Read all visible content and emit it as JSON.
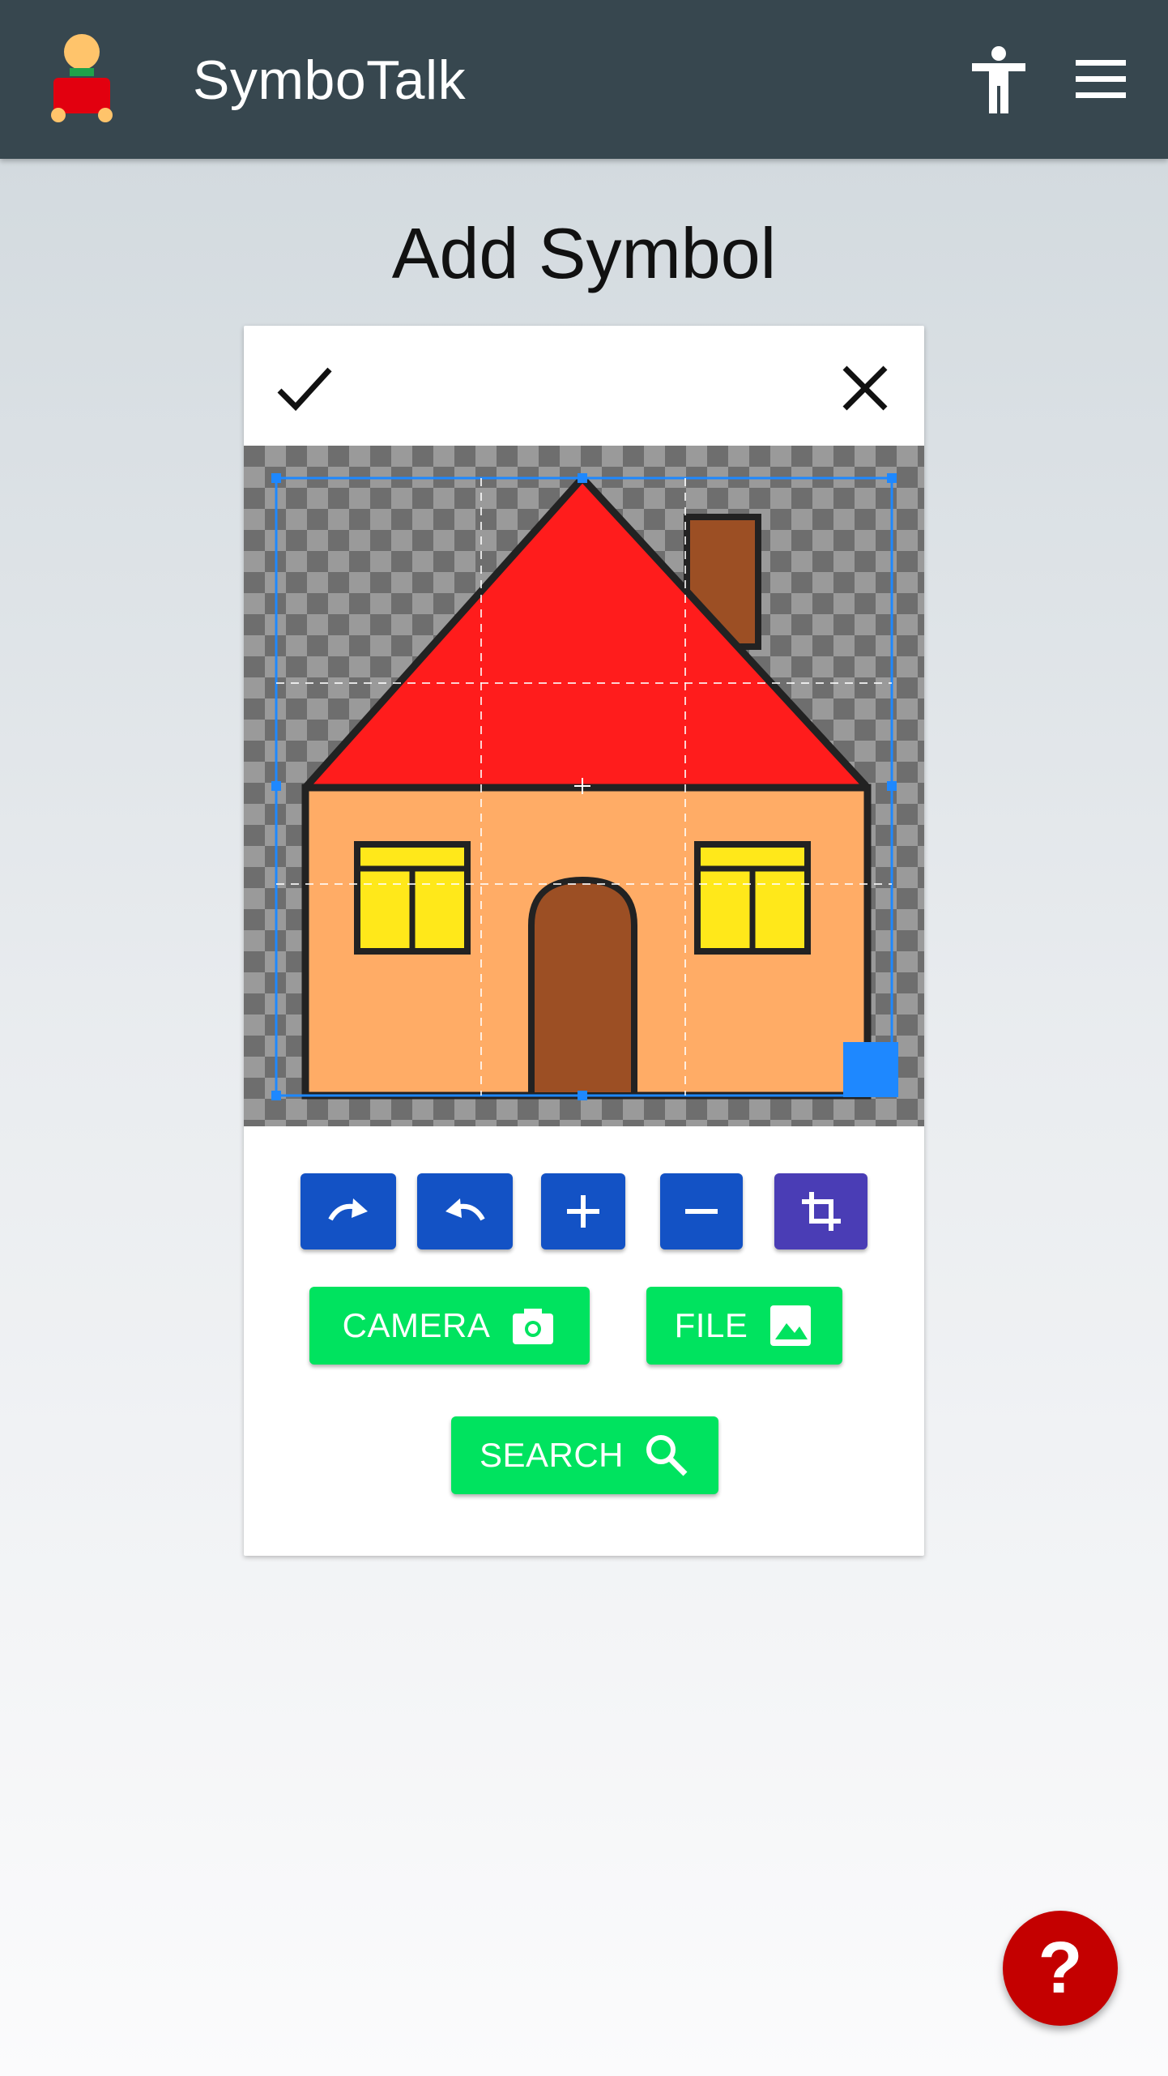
{
  "app": {
    "title": "SymboTalk"
  },
  "page": {
    "title": "Add Symbol"
  },
  "editor": {
    "image_subject": "house",
    "crop_handles": true
  },
  "tools": [
    {
      "name": "rotate-right",
      "icon": "redo-icon"
    },
    {
      "name": "rotate-left",
      "icon": "undo-icon"
    },
    {
      "name": "zoom-in",
      "icon": "plus-icon"
    },
    {
      "name": "zoom-out",
      "icon": "minus-icon"
    },
    {
      "name": "crop",
      "icon": "crop-icon"
    }
  ],
  "actions": {
    "camera_label": "CAMERA",
    "file_label": "FILE",
    "search_label": "SEARCH"
  },
  "help": {
    "label": "?"
  },
  "colors": {
    "appbar": "#37474f",
    "tool_blue": "#1352c5",
    "crop_purple": "#4a3db5",
    "action_green": "#00e35f",
    "help_red": "#c40000",
    "selection_blue": "#1e88ff"
  }
}
